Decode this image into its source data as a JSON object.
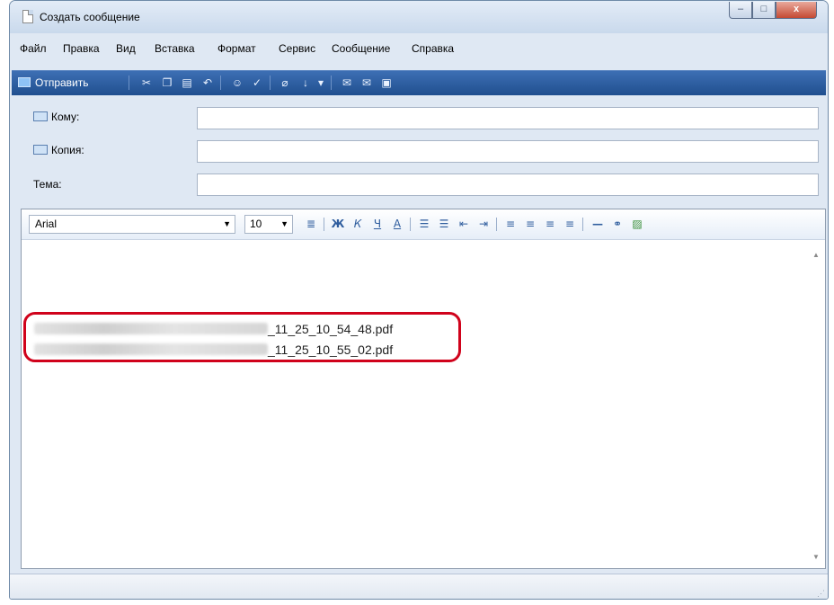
{
  "window": {
    "title": "Создать сообщение",
    "controls": {
      "minimize": "–",
      "maximize": "□",
      "close": "x"
    }
  },
  "menu": {
    "items": [
      "Файл",
      "Правка",
      "Вид",
      "Вставка",
      "Формат",
      "Сервис",
      "Сообщение",
      "Справка"
    ]
  },
  "toolbar": {
    "send_label": "Отправить",
    "icons": [
      "cut-icon",
      "copy-icon",
      "paste-icon",
      "undo-icon",
      "check-names-icon",
      "spelling-icon",
      "attach-icon",
      "priority-icon",
      "priority-dropdown-icon",
      "sign-icon",
      "encrypt-icon",
      "offline-icon"
    ]
  },
  "headers": {
    "to_label": "Кому:",
    "to_value": "",
    "cc_label": "Копия:",
    "cc_value": "",
    "subject_label": "Тема:",
    "subject_value": ""
  },
  "format": {
    "font": "Arial",
    "size": "10",
    "icons": [
      "paragraph-style-icon",
      "bold-icon",
      "italic-icon",
      "underline-icon",
      "font-color-icon",
      "numbered-list-icon",
      "bullet-list-icon",
      "decrease-indent-icon",
      "increase-indent-icon",
      "align-left-icon",
      "align-center-icon",
      "align-right-icon",
      "justify-icon",
      "horizontal-line-icon",
      "hyperlink-icon",
      "insert-picture-icon"
    ]
  },
  "body": {
    "attachments": [
      {
        "suffix": "_11_25_10_54_48.pdf"
      },
      {
        "suffix": "_11_25_10_55_02.pdf"
      }
    ]
  },
  "colors": {
    "toolbar_bg": "#2b5ba0",
    "highlight": "#d0021b",
    "window_bg": "#dfe8f3"
  }
}
